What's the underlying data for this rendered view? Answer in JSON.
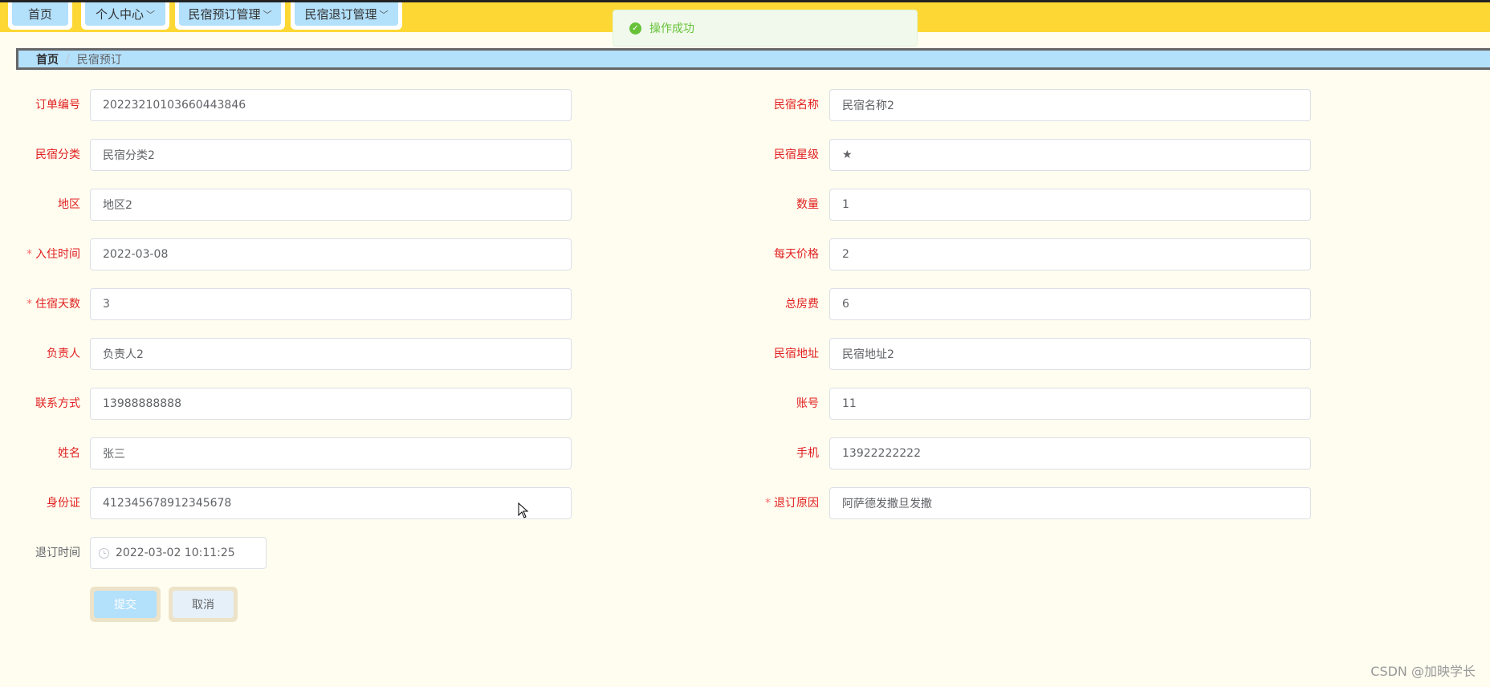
{
  "nav": {
    "items": [
      {
        "label": "首页",
        "dropdown": false
      },
      {
        "label": "个人中心",
        "dropdown": true
      },
      {
        "label": "民宿预订管理",
        "dropdown": true
      },
      {
        "label": "民宿退订管理",
        "dropdown": true
      }
    ]
  },
  "toast": {
    "message": "操作成功"
  },
  "breadcrumb": {
    "home": "首页",
    "separator": "/",
    "current": "民宿预订"
  },
  "form": {
    "order_no": {
      "label": "订单编号",
      "value": "20223210103660443846"
    },
    "homestay_name": {
      "label": "民宿名称",
      "value": "民宿名称2"
    },
    "category": {
      "label": "民宿分类",
      "value": "民宿分类2"
    },
    "star_level": {
      "label": "民宿星级",
      "value": "★"
    },
    "region": {
      "label": "地区",
      "value": "地区2"
    },
    "quantity": {
      "label": "数量",
      "value": "1"
    },
    "checkin_date": {
      "label": "入住时间",
      "value": "2022-03-08",
      "required_mark": "*"
    },
    "daily_price": {
      "label": "每天价格",
      "value": "2"
    },
    "stay_days": {
      "label": "住宿天数",
      "value": "3",
      "required_mark": "*"
    },
    "total_fee": {
      "label": "总房费",
      "value": "6"
    },
    "manager": {
      "label": "负责人",
      "value": "负责人2"
    },
    "address": {
      "label": "民宿地址",
      "value": "民宿地址2"
    },
    "contact": {
      "label": "联系方式",
      "value": "13988888888"
    },
    "account": {
      "label": "账号",
      "value": "11"
    },
    "name": {
      "label": "姓名",
      "value": "张三"
    },
    "phone": {
      "label": "手机",
      "value": "13922222222"
    },
    "id_card": {
      "label": "身份证",
      "value": "412345678912345678"
    },
    "cancel_reason": {
      "label": "退订原因",
      "value": "阿萨德发撒旦发撒",
      "required_mark": "*"
    },
    "cancel_time": {
      "label": "退订时间",
      "value": "2022-03-02 10:11:25"
    }
  },
  "buttons": {
    "submit": "提交",
    "cancel": "取消"
  },
  "watermark": "CSDN @加映学长",
  "colors": {
    "nav_bg": "#fdd835",
    "nav_item_bg": "#b3e0fb",
    "label_red": "#e02020",
    "page_bg": "#fffdf0"
  }
}
